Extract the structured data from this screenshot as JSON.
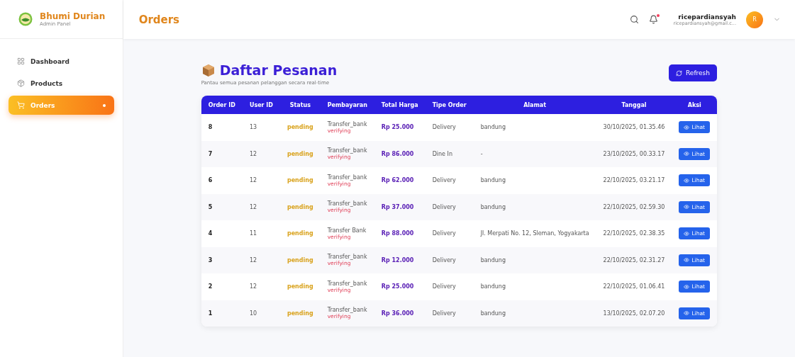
{
  "brand": {
    "name": "Bhumi Durian",
    "subtitle": "Admin Panel"
  },
  "sidebar": {
    "items": [
      {
        "label": "Dashboard",
        "selected": false
      },
      {
        "label": "Products",
        "selected": false
      },
      {
        "label": "Orders",
        "selected": true
      }
    ]
  },
  "header": {
    "title": "Orders",
    "notification": true,
    "user": {
      "name": "ricepardiansyah",
      "email": "ricepardiansyah@gmail.c...",
      "initial": "R"
    }
  },
  "page": {
    "title": "Daftar Pesanan",
    "subtitle": "Pantau semua pesanan pelanggan secara real-time",
    "refresh": "Refresh"
  },
  "table": {
    "columns": [
      "Order ID",
      "User ID",
      "Status",
      "Pembayaran",
      "Total Harga",
      "Tipe Order",
      "Alamat",
      "Tanggal",
      "Aksi"
    ],
    "rows": [
      {
        "order_id": "8",
        "user_id": "13",
        "status": "pending",
        "payment": "Transfer_bank",
        "payment_status": "verifying",
        "total": "Rp 25.000",
        "type": "Delivery",
        "address": "bandung",
        "date": "30/10/2025, 01.35.46",
        "action": "Lihat"
      },
      {
        "order_id": "7",
        "user_id": "12",
        "status": "pending",
        "payment": "Transfer_bank",
        "payment_status": "verifying",
        "total": "Rp 86.000",
        "type": "Dine In",
        "address": "-",
        "date": "23/10/2025, 00.33.17",
        "action": "Lihat"
      },
      {
        "order_id": "6",
        "user_id": "12",
        "status": "pending",
        "payment": "Transfer_bank",
        "payment_status": "verifying",
        "total": "Rp 62.000",
        "type": "Delivery",
        "address": "bandung",
        "date": "22/10/2025, 03.21.17",
        "action": "Lihat"
      },
      {
        "order_id": "5",
        "user_id": "12",
        "status": "pending",
        "payment": "Transfer_bank",
        "payment_status": "verifying",
        "total": "Rp 37.000",
        "type": "Delivery",
        "address": "bandung",
        "date": "22/10/2025, 02.59.30",
        "action": "Lihat"
      },
      {
        "order_id": "4",
        "user_id": "11",
        "status": "pending",
        "payment": "Transfer Bank",
        "payment_status": "verifying",
        "total": "Rp 88.000",
        "type": "Delivery",
        "address": "Jl. Merpati No. 12, Sleman, Yogyakarta",
        "date": "22/10/2025, 02.38.35",
        "action": "Lihat"
      },
      {
        "order_id": "3",
        "user_id": "12",
        "status": "pending",
        "payment": "Transfer_bank",
        "payment_status": "verifying",
        "total": "Rp 12.000",
        "type": "Delivery",
        "address": "bandung",
        "date": "22/10/2025, 02.31.27",
        "action": "Lihat"
      },
      {
        "order_id": "2",
        "user_id": "12",
        "status": "pending",
        "payment": "Transfer_bank",
        "payment_status": "verifying",
        "total": "Rp 25.000",
        "type": "Delivery",
        "address": "bandung",
        "date": "22/10/2025, 01.06.41",
        "action": "Lihat"
      },
      {
        "order_id": "1",
        "user_id": "10",
        "status": "pending",
        "payment": "Transfer_bank",
        "payment_status": "verifying",
        "total": "Rp 36.000",
        "type": "Delivery",
        "address": "bandung",
        "date": "13/10/2025, 02.07.20",
        "action": "Lihat"
      }
    ]
  }
}
